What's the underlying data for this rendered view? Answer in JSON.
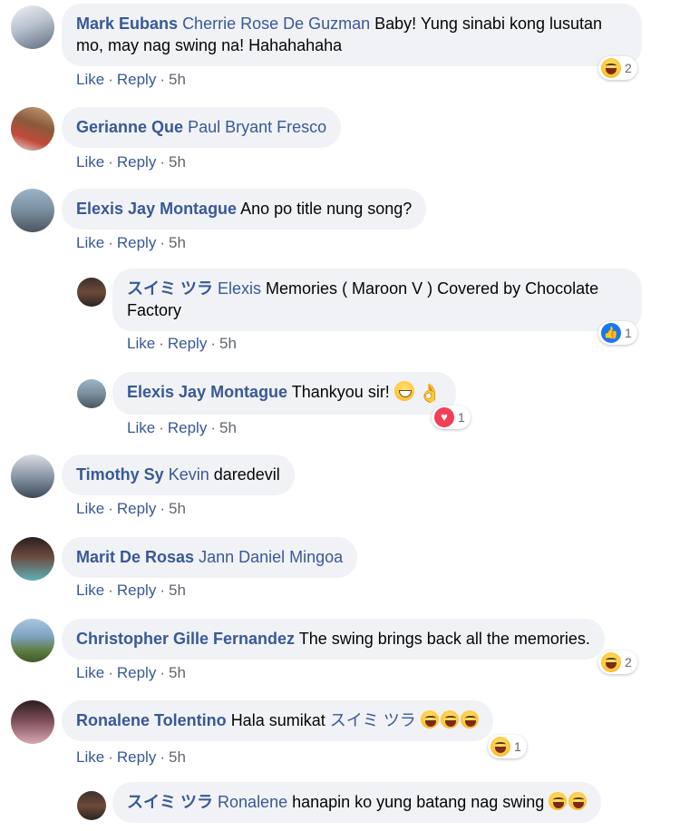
{
  "actions": {
    "like": "Like",
    "reply": "Reply",
    "sep": "·"
  },
  "comments": [
    {
      "author": "Mark Eubans",
      "tag": "Cherrie Rose De Guzman",
      "text": " Baby! Yung sinabi kong lusutan mo, may nag swing na! Hahahahaha",
      "time": "5h",
      "reaction": {
        "type": "haha-icon",
        "count": "2"
      }
    },
    {
      "author": "Gerianne Que",
      "tag": "Paul Bryant Fresco",
      "text": "",
      "time": "5h"
    },
    {
      "author": "Elexis Jay Montague",
      "tag": "",
      "text": "Ano po title nung song?",
      "time": "5h"
    },
    {
      "author": "スイミ ツラ",
      "tag": "Elexis",
      "text": " Memories ( Maroon V ) Covered by Chocolate Factory",
      "time": "5h",
      "reaction": {
        "type": "like-icon",
        "count": "1"
      }
    },
    {
      "author": "Elexis Jay Montague",
      "tag": "",
      "text": "Thankyou sir!",
      "time": "5h",
      "reaction": {
        "type": "love-icon",
        "count": "1"
      }
    },
    {
      "author": "Timothy Sy",
      "tag": "Kevin",
      "text": " daredevil",
      "time": "5h"
    },
    {
      "author": "Marit De Rosas",
      "tag": "Jann Daniel Mingoa",
      "text": "",
      "time": "5h"
    },
    {
      "author": "Christopher Gille Fernandez",
      "tag": "",
      "text": "The swing brings back all the memories.",
      "time": "5h",
      "reaction": {
        "type": "haha-icon",
        "count": "2"
      }
    },
    {
      "author": "Ronalene Tolentino",
      "tag": "",
      "text": "Hala sumikat ",
      "tag_after": "スイミ ツラ",
      "time": "5h",
      "reaction": {
        "type": "haha-icon",
        "count": "1"
      }
    },
    {
      "author": "スイミ ツラ",
      "tag": "Ronalene",
      "text": " hanapin ko yung batang nag swing",
      "time": ""
    }
  ],
  "colors": {
    "link": "#385898",
    "bubble": "#f0f2f5",
    "meta": "#606770"
  }
}
